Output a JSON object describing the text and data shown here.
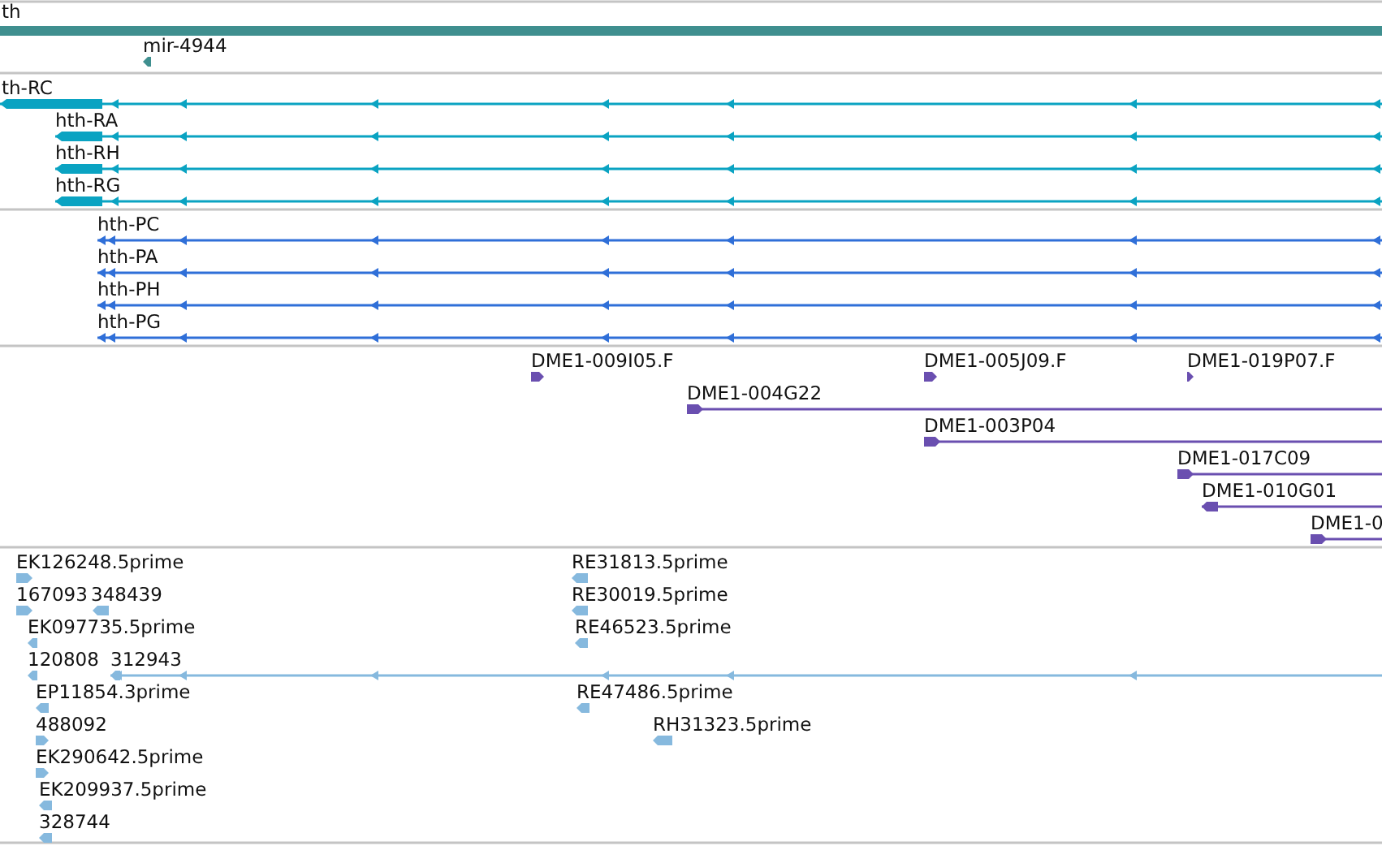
{
  "tracks": [
    {
      "color": "#3f8f8f",
      "features": [
        {
          "label": "th",
          "kind": "gene"
        },
        {
          "label": "mir-4944",
          "kind": "marker",
          "reverse": true
        }
      ]
    },
    {
      "color": "#0aa3c2",
      "features": [
        {
          "label": "th-RC",
          "kind": "transcript",
          "reverse": true
        },
        {
          "label": "hth-RA",
          "kind": "transcript",
          "reverse": true
        },
        {
          "label": "hth-RH",
          "kind": "transcript",
          "reverse": true
        },
        {
          "label": "hth-RG",
          "kind": "transcript",
          "reverse": true
        }
      ]
    },
    {
      "color": "#2f6fd8",
      "features": [
        {
          "label": "hth-PC",
          "kind": "transcript",
          "reverse": true
        },
        {
          "label": "hth-PA",
          "kind": "transcript",
          "reverse": true
        },
        {
          "label": "hth-PH",
          "kind": "transcript",
          "reverse": true
        },
        {
          "label": "hth-PG",
          "kind": "transcript",
          "reverse": true
        }
      ]
    },
    {
      "color": "#6a4fb0",
      "features": [
        {
          "label": "DME1-009I05.F",
          "kind": "marker",
          "reverse": false
        },
        {
          "label": "DME1-005J09.F",
          "kind": "marker",
          "reverse": false
        },
        {
          "label": "DME1-019P07.F",
          "kind": "marker",
          "reverse": false
        },
        {
          "label": "DME1-004G22",
          "kind": "span",
          "reverse": false
        },
        {
          "label": "DME1-003P04",
          "kind": "span",
          "reverse": false
        },
        {
          "label": "DME1-017C09",
          "kind": "span",
          "reverse": false
        },
        {
          "label": "DME1-010G01",
          "kind": "span",
          "reverse": true
        },
        {
          "label": "DME1-0",
          "kind": "span",
          "reverse": false
        }
      ]
    },
    {
      "color": "#86b9de",
      "features": [
        {
          "label": "EK126248.5prime",
          "kind": "marker",
          "reverse": false
        },
        {
          "label": "RE31813.5prime",
          "kind": "marker",
          "reverse": true
        },
        {
          "label": "167093",
          "kind": "marker",
          "reverse": false
        },
        {
          "label": "348439",
          "kind": "marker",
          "reverse": true
        },
        {
          "label": "RE30019.5prime",
          "kind": "marker",
          "reverse": true
        },
        {
          "label": "EK097735.5prime",
          "kind": "marker",
          "reverse": true
        },
        {
          "label": "RE46523.5prime",
          "kind": "marker",
          "reverse": true
        },
        {
          "label": "120808",
          "kind": "marker",
          "reverse": true
        },
        {
          "label": "312943",
          "kind": "span",
          "reverse": true
        },
        {
          "label": "EP11854.3prime",
          "kind": "marker",
          "reverse": true
        },
        {
          "label": "RE47486.5prime",
          "kind": "marker",
          "reverse": true
        },
        {
          "label": "488092",
          "kind": "marker",
          "reverse": false
        },
        {
          "label": "RH31323.5prime",
          "kind": "marker",
          "reverse": true
        },
        {
          "label": "EK290642.5prime",
          "kind": "marker",
          "reverse": false
        },
        {
          "label": "EK209937.5prime",
          "kind": "marker",
          "reverse": true
        },
        {
          "label": "328744",
          "kind": "marker",
          "reverse": true
        }
      ]
    }
  ]
}
